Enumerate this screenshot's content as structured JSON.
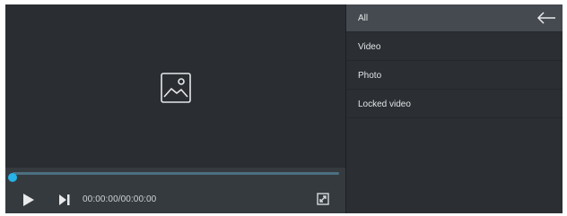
{
  "player": {
    "time_display": "00:00:00/00:00:00",
    "progress": 0.0,
    "icons": {
      "placeholder": "image-icon",
      "play": "play-icon",
      "next": "skip-next-icon",
      "fullscreen": "fullscreen-icon"
    }
  },
  "menu": {
    "back_icon": "arrow-left-icon",
    "items": [
      {
        "label": "All",
        "active": true
      },
      {
        "label": "Video",
        "active": false
      },
      {
        "label": "Photo",
        "active": false
      },
      {
        "label": "Locked video",
        "active": false
      }
    ]
  },
  "colors": {
    "accent": "#27b2e8",
    "panel_bg": "#2b2e32",
    "active_item_bg": "#454a50"
  }
}
